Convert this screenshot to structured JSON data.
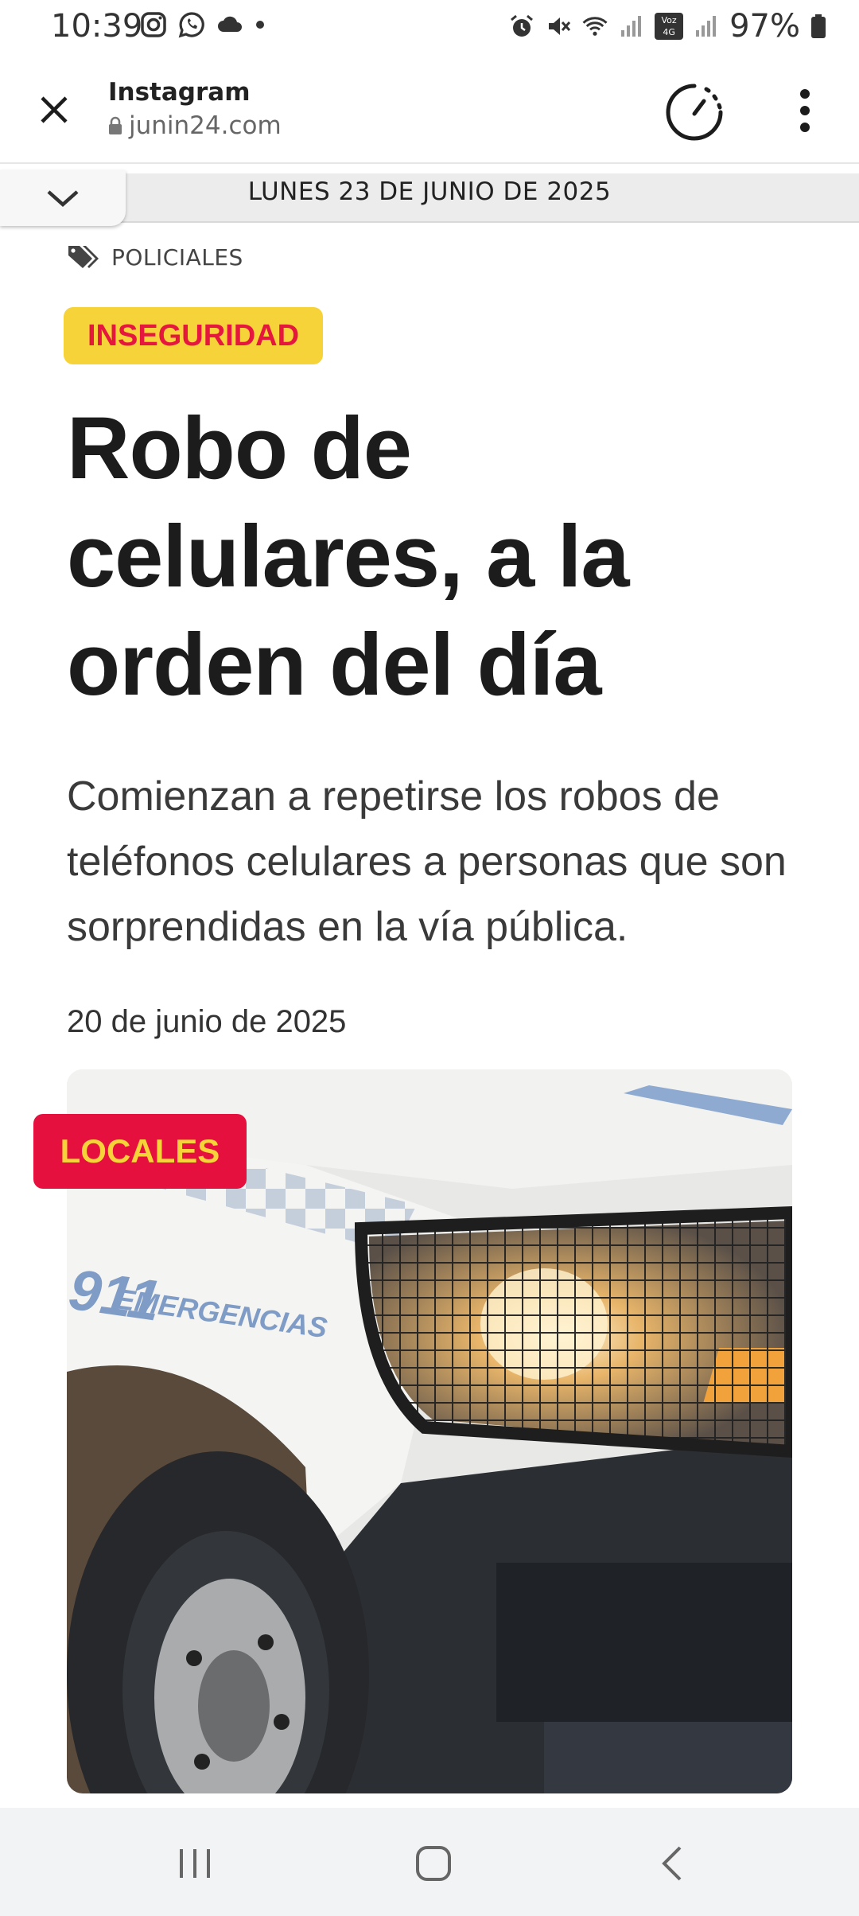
{
  "status_bar": {
    "time": "10:39",
    "left_icons": [
      "instagram-icon",
      "whatsapp-icon",
      "cloud-icon",
      "dot-icon"
    ],
    "right_icons": [
      "alarm-icon",
      "mute-icon",
      "wifi-icon",
      "signal-icon",
      "volte-4g-icon",
      "signal-icon"
    ],
    "network_label": "Voz 4G",
    "battery_percent": "97%"
  },
  "browser": {
    "title": "Instagram",
    "url": "junin24.com",
    "close_icon": "close-icon",
    "lock_icon": "lock-icon",
    "speed_icon": "speedometer-icon",
    "menu_icon": "more-vertical-icon"
  },
  "date_strip": {
    "text": "LUNES 23 DE JUNIO DE 2025",
    "toggle_icon": "chevron-down-icon"
  },
  "article": {
    "category_icon": "tags-icon",
    "category": "POLICIALES",
    "tag": "INSEGURIDAD",
    "headline": "Robo de celulares, a la orden del día",
    "lede": "Comienzan a repetirse los robos de teléfonos celulares a personas que son sorprendidas en la vía pública.",
    "date": "20 de junio de 2025",
    "image_badge": "LOCALES",
    "image_text": "911 EMERGENCIAS"
  },
  "colors": {
    "tag_bg": "#f6d339",
    "tag_text": "#e5173f",
    "locales_bg": "#e6103f",
    "locales_text": "#f6d339"
  },
  "nav_bar": {
    "icons": [
      "recent-apps-icon",
      "home-icon",
      "back-icon"
    ]
  }
}
